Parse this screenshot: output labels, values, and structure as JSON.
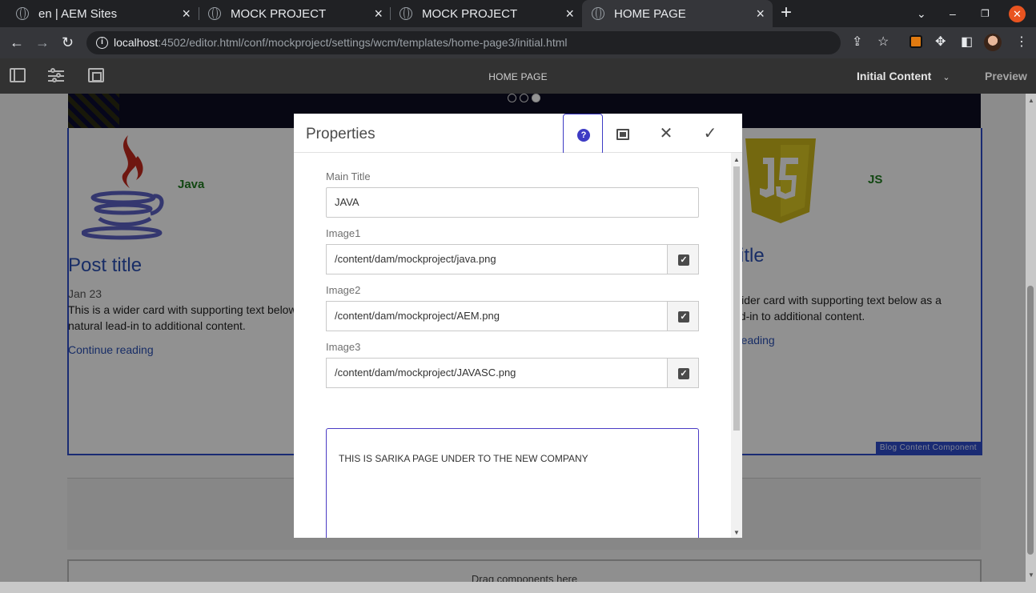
{
  "browser": {
    "tabs": [
      {
        "title": "en | AEM Sites",
        "close": "×"
      },
      {
        "title": "MOCK PROJECT",
        "close": "×"
      },
      {
        "title": "MOCK PROJECT",
        "close": "×"
      },
      {
        "title": "HOME PAGE",
        "close": "×",
        "active": true
      }
    ],
    "new_tab": "+",
    "url_host": "localhost",
    "url_rest": ":4502/editor.html/conf/mockproject/settings/wcm/templates/home-page3/initial.html"
  },
  "editor": {
    "page_title": "HOME PAGE",
    "mode": "Initial Content",
    "mode_chevron": "⌄",
    "preview": "Preview"
  },
  "page": {
    "card1": {
      "label": "Java",
      "post_title": "Post title",
      "date": "Jan 23",
      "text_line1": "This is a wider card with supporting text below",
      "text_line2": "natural lead-in to additional content.",
      "link": "Continue reading"
    },
    "card3": {
      "label": "JS",
      "post_title_partial": "itle",
      "text_line1": "wider card with supporting text below as a",
      "text_line2": "ad-in to additional content.",
      "link_partial": "reading"
    },
    "component_label": "Blog Content Component",
    "drag_text": "Drag components here"
  },
  "dialog": {
    "title": "Properties",
    "help_glyph": "?",
    "close_glyph": "✕",
    "done_glyph": "✓",
    "fields": {
      "main_title_label": "Main Title",
      "main_title_value": "JAVA",
      "image1_label": "Image1",
      "image1_value": "/content/dam/mockproject/java.png",
      "image2_label": "Image2",
      "image2_value": "/content/dam/mockproject/AEM.png",
      "image3_label": "Image3",
      "image3_value": "/content/dam/mockproject/JAVASC.png",
      "description_value": "THIS IS SARIKA PAGE UNDER TO THE NEW COMPANY"
    }
  },
  "colors": {
    "accent": "#3d3bc4",
    "component_border": "#2d4bc7",
    "browser_dark": "#202124"
  }
}
